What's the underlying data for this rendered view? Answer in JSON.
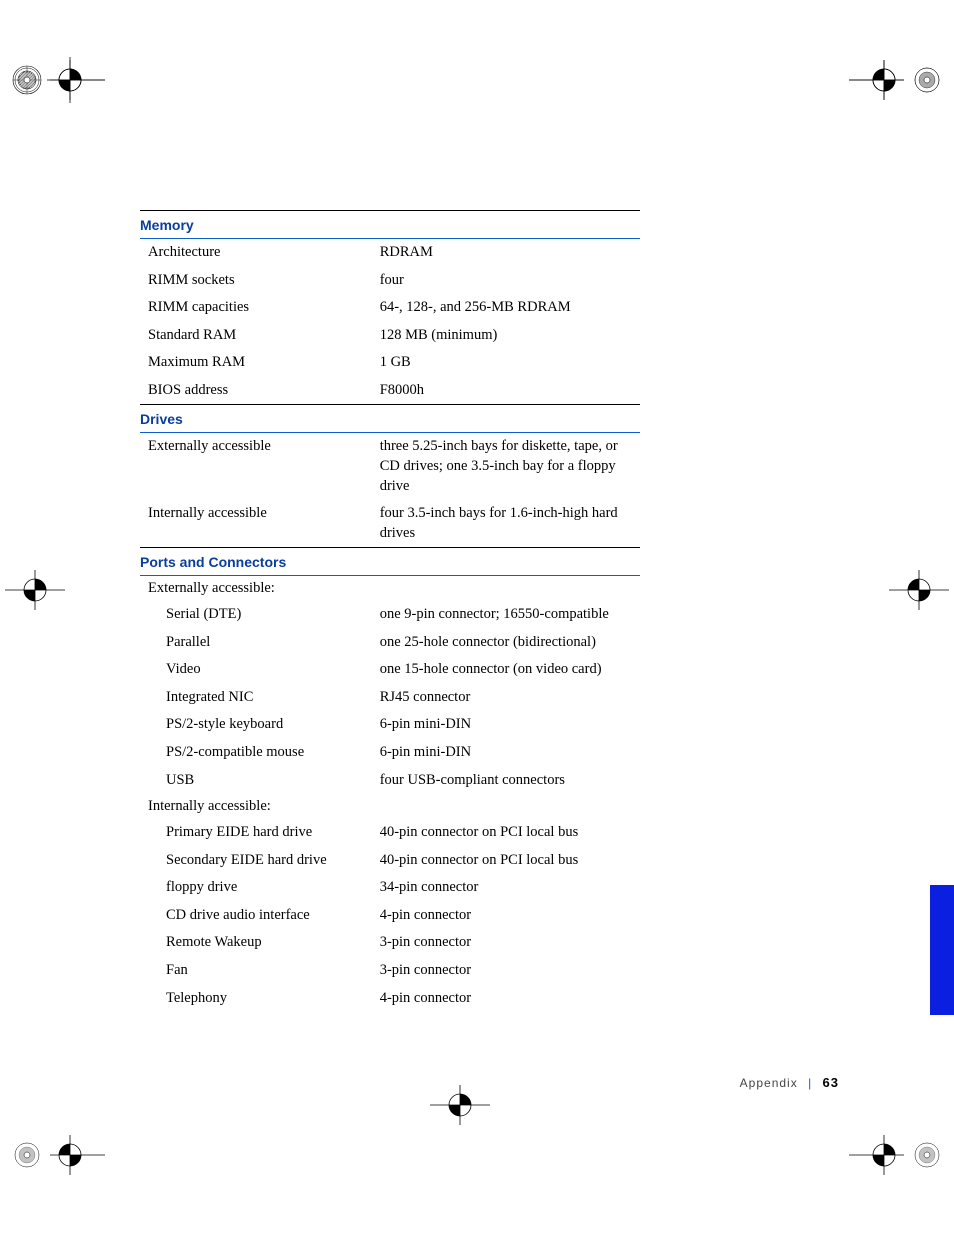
{
  "sections": [
    {
      "title": "Memory",
      "rows": [
        {
          "label": "Architecture",
          "value": "RDRAM"
        },
        {
          "label": "RIMM sockets",
          "value": "four"
        },
        {
          "label": "RIMM capacities",
          "value": "64-, 128-, and 256-MB RDRAM"
        },
        {
          "label": "Standard RAM",
          "value": "128 MB (minimum)"
        },
        {
          "label": "Maximum RAM",
          "value": "1 GB"
        },
        {
          "label": "BIOS address",
          "value": "F8000h"
        }
      ]
    },
    {
      "title": "Drives",
      "rows": [
        {
          "label": "Externally accessible",
          "value": "three 5.25-inch bays for diskette, tape, or CD drives; one 3.5-inch bay for a floppy drive"
        },
        {
          "label": "Internally accessible",
          "value": "four 3.5-inch bays for 1.6-inch-high hard drives"
        }
      ]
    },
    {
      "title": "Ports and Connectors",
      "groups": [
        {
          "subhead": "Externally accessible:",
          "rows": [
            {
              "label": "Serial (DTE)",
              "value": "one 9-pin connector; 16550-compatible"
            },
            {
              "label": "Parallel",
              "value": "one 25-hole connector (bidirectional)"
            },
            {
              "label": "Video",
              "value": "one 15-hole connector (on video card)"
            },
            {
              "label": "Integrated NIC",
              "value": "RJ45 connector"
            },
            {
              "label": "PS/2-style keyboard",
              "value": "6-pin mini-DIN"
            },
            {
              "label": "PS/2-compatible mouse",
              "value": "6-pin mini-DIN"
            },
            {
              "label": "USB",
              "value": "four USB-compliant connectors"
            }
          ]
        },
        {
          "subhead": "Internally accessible:",
          "rows": [
            {
              "label": "Primary EIDE hard drive",
              "value": "40-pin connector on PCI local bus"
            },
            {
              "label": "Secondary EIDE hard drive",
              "value": "40-pin connector on PCI local bus"
            },
            {
              "label": "floppy drive",
              "value": "34-pin connector"
            },
            {
              "label": "CD drive audio interface",
              "value": "4-pin connector"
            },
            {
              "label": "Remote Wakeup",
              "value": "3-pin connector"
            },
            {
              "label": "Fan",
              "value": "3-pin connector"
            },
            {
              "label": "Telephony",
              "value": "4-pin connector"
            }
          ]
        }
      ]
    }
  ],
  "footer": {
    "section": "Appendix",
    "page": "63"
  }
}
